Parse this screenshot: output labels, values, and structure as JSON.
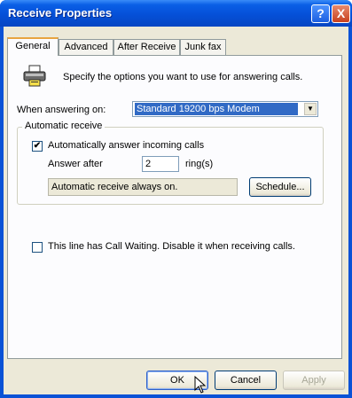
{
  "window": {
    "title": "Receive Properties"
  },
  "title_buttons": {
    "help": "?",
    "close": "X"
  },
  "tabs": [
    {
      "label": "General",
      "active": true
    },
    {
      "label": "Advanced",
      "active": false
    },
    {
      "label": "After Receive",
      "active": false
    },
    {
      "label": "Junk fax",
      "active": false
    }
  ],
  "general": {
    "description": "Specify the options you want to use for answering calls.",
    "when_answering_label": "When answering on:",
    "modem_selected": "Standard 19200 bps Modem",
    "auto_receive_group_title": "Automatic receive",
    "auto_answer_label": "Automatically answer incoming calls",
    "auto_answer_checked": true,
    "answer_after_label": "Answer after",
    "answer_after_value": "2",
    "rings_label": "ring(s)",
    "status_text": "Automatic receive always on.",
    "schedule_button": "Schedule...",
    "call_waiting_label": "This line has Call Waiting. Disable it when receiving calls.",
    "call_waiting_checked": false
  },
  "footer": {
    "ok": "OK",
    "cancel": "Cancel",
    "apply": "Apply"
  },
  "icons": {
    "fax": "fax-machine-icon",
    "dropdown": "chevron-down-icon",
    "check": "checkmark-icon",
    "cursor": "mouse-pointer-icon"
  }
}
